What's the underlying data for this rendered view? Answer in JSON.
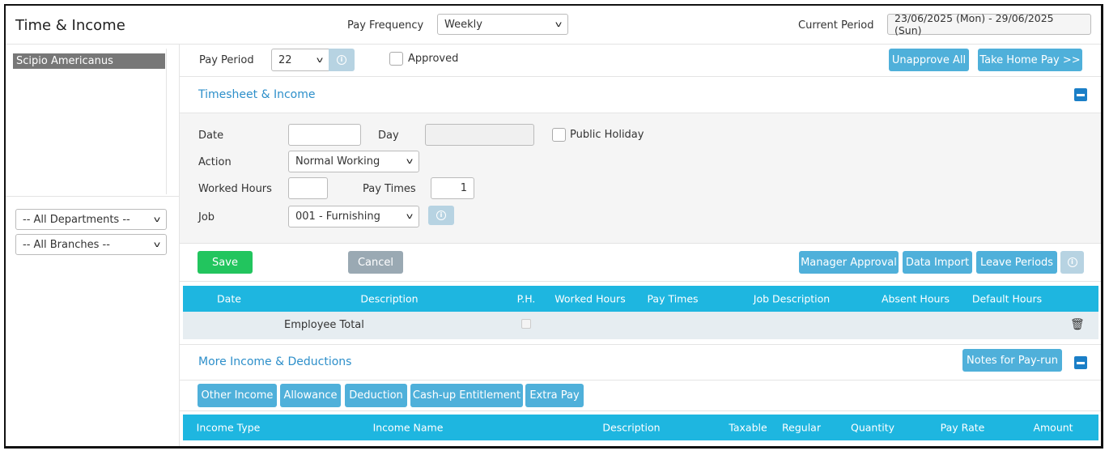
{
  "header": {
    "title": "Time & Income",
    "pay_frequency_label": "Pay Frequency",
    "pay_frequency_value": "Weekly",
    "current_period_label": "Current Period",
    "current_period_value": "23/06/2025 (Mon) - 29/06/2025 (Sun)"
  },
  "sidebar": {
    "employees": [
      "Scipio Americanus"
    ],
    "department": "-- All Departments --",
    "branch": "-- All Branches --"
  },
  "toolbar": {
    "pay_period_label": "Pay Period",
    "pay_period_value": "22",
    "approved_label": "Approved",
    "unapprove_all": "Unapprove All",
    "take_home_pay": "Take Home Pay >>"
  },
  "timesheet": {
    "title": "Timesheet & Income",
    "date_label": "Date",
    "date_value": "",
    "day_label": "Day",
    "day_value": "",
    "public_holiday_label": "Public Holiday",
    "action_label": "Action",
    "action_value": "Normal Working",
    "worked_hours_label": "Worked Hours",
    "worked_hours_value": "",
    "pay_times_label": "Pay Times",
    "pay_times_value": "1",
    "job_label": "Job",
    "job_value": "001 - Furnishing",
    "save": "Save",
    "cancel": "Cancel",
    "manager_approval": "Manager Approval",
    "data_import": "Data Import",
    "leave_periods": "Leave Periods",
    "columns": [
      "Date",
      "Description",
      "P.H.",
      "Worked Hours",
      "Pay Times",
      "Job Description",
      "Absent Hours",
      "Default Hours"
    ],
    "total_row_label": "Employee Total"
  },
  "more": {
    "title": "More Income & Deductions",
    "notes": "Notes for Pay-run",
    "tabs": [
      "Other Income",
      "Allowance",
      "Deduction",
      "Cash-up Entitlement",
      "Extra Pay"
    ],
    "columns": [
      "Income Type",
      "Income Name",
      "Description",
      "Taxable",
      "Regular",
      "Quantity",
      "Pay Rate",
      "Amount"
    ]
  },
  "colors": {
    "accent": "#4fb0da",
    "table_header": "#1eb6e0",
    "save": "#22c55e",
    "section_title": "#2d8fca"
  }
}
